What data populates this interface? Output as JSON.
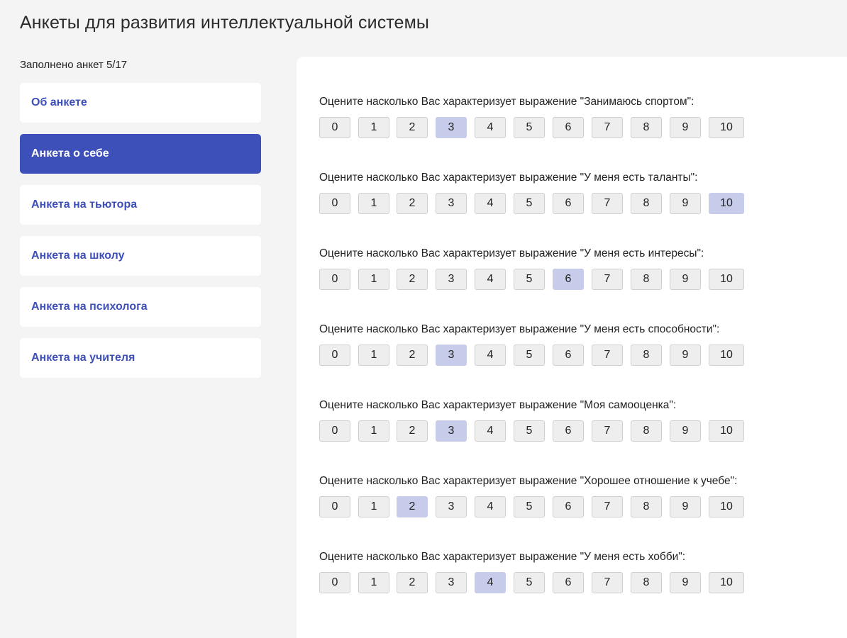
{
  "page": {
    "title": "Анкеты для развития интеллектуальной системы",
    "progress": "Заполнено анкет 5/17"
  },
  "sidebar": {
    "items": [
      {
        "label": "Об анкете",
        "active": false
      },
      {
        "label": "Анкета о себе",
        "active": true
      },
      {
        "label": "Анкета на тьютора",
        "active": false
      },
      {
        "label": "Анкета на школу",
        "active": false
      },
      {
        "label": "Анкета на психолога",
        "active": false
      },
      {
        "label": "Анкета на учителя",
        "active": false
      }
    ]
  },
  "scale": [
    "0",
    "1",
    "2",
    "3",
    "4",
    "5",
    "6",
    "7",
    "8",
    "9",
    "10"
  ],
  "questions": [
    {
      "text": "Оцените насколько Вас характеризует выражение \"Занимаюсь спортом\":",
      "selected": 3
    },
    {
      "text": "Оцените насколько Вас характеризует выражение \"У меня есть таланты\":",
      "selected": 10
    },
    {
      "text": "Оцените насколько Вас характеризует выражение \"У меня есть интересы\":",
      "selected": 6
    },
    {
      "text": "Оцените насколько Вас характеризует выражение \"У меня есть способности\":",
      "selected": 3
    },
    {
      "text": "Оцените насколько Вас характеризует выражение \"Моя самооценка\":",
      "selected": 3
    },
    {
      "text": "Оцените насколько Вас характеризует выражение \"Хорошее отношение к учебе\":",
      "selected": 2
    },
    {
      "text": "Оцените насколько Вас характеризует выражение \"У меня есть хобби\":",
      "selected": 4
    }
  ],
  "colors": {
    "accent": "#3d4fb8",
    "selected_option": "#c8cceb",
    "option_bg": "#eeeeee",
    "page_bg": "#f4f4f4"
  }
}
